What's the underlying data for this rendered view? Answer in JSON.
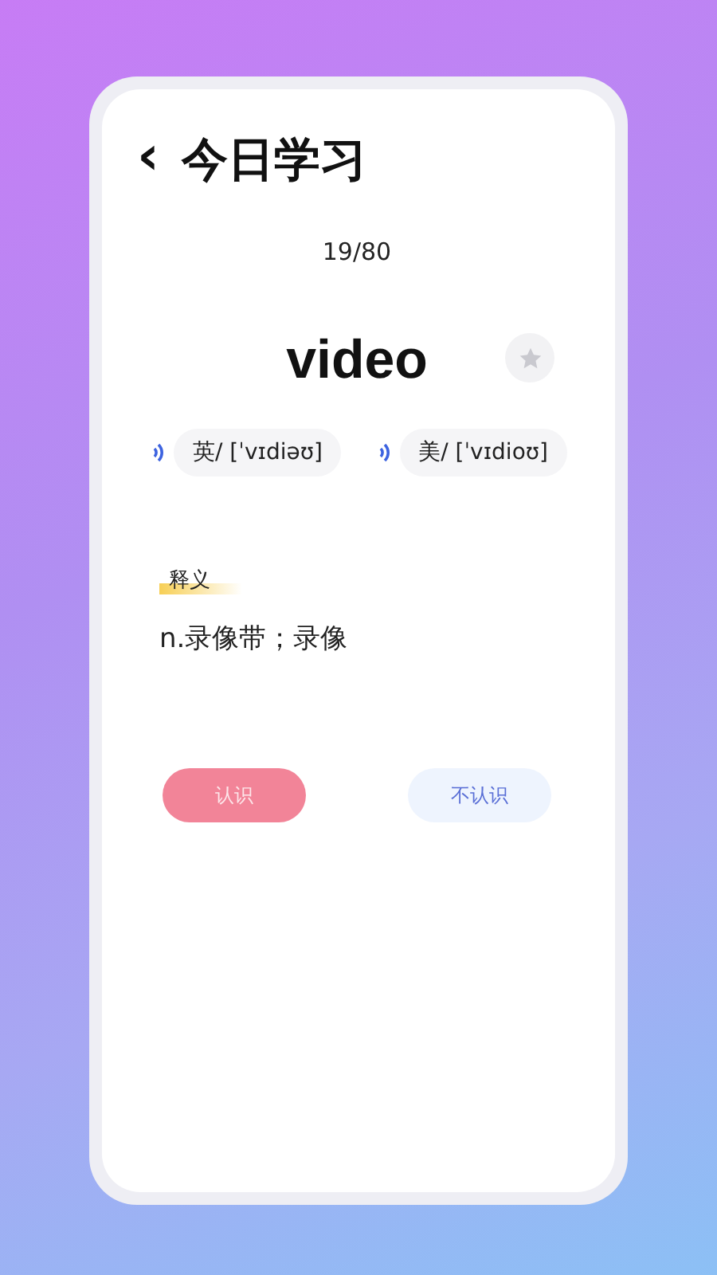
{
  "header": {
    "back": "‹",
    "title": "今日学习"
  },
  "progress": "19/80",
  "word": {
    "text": "video",
    "favorited": false
  },
  "pronunciations": [
    {
      "label": "英/ [ˈvɪdiəʊ]"
    },
    {
      "label": "美/ [ˈvɪdioʊ]"
    }
  ],
  "definition": {
    "label": "释义",
    "text": "n.录像带；录像"
  },
  "buttons": [
    {
      "label": "认识",
      "kind": "primary"
    },
    {
      "label": "不认识",
      "kind": "secondary"
    }
  ]
}
